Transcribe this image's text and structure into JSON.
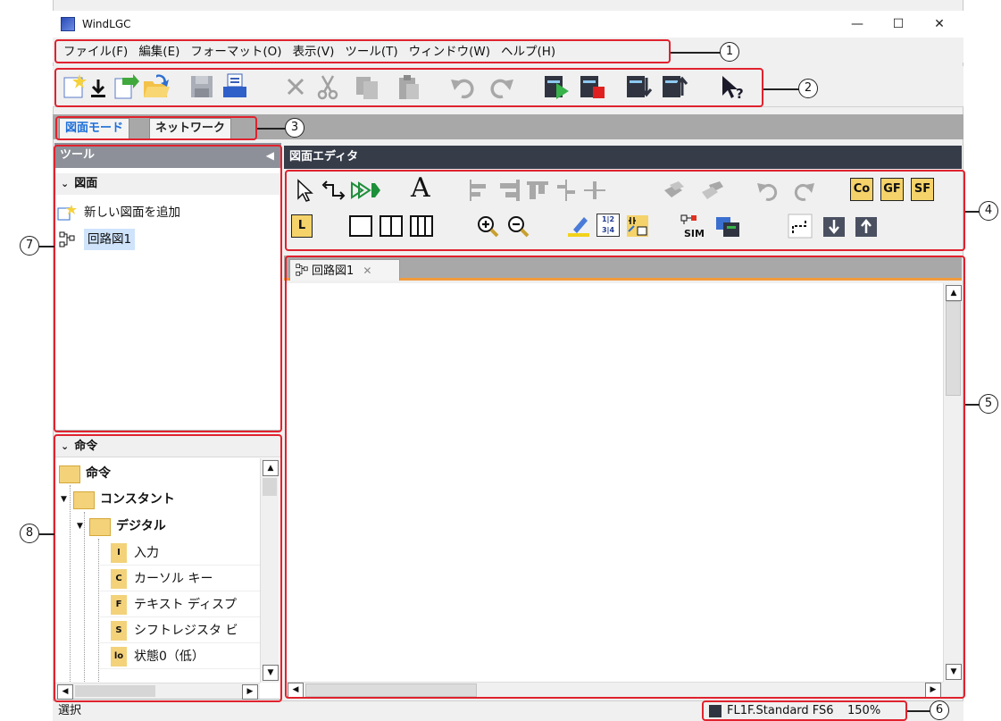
{
  "window": {
    "title": "WindLGC",
    "controls": [
      "—",
      "☐",
      "✕"
    ]
  },
  "menu": [
    "ファイル(F)",
    "編集(E)",
    "フォーマット(O)",
    "表示(V)",
    "ツール(T)",
    "ウィンドウ(W)",
    "ヘルプ(H)"
  ],
  "mode_tabs": {
    "diagram": "図面モード",
    "network": "ネットワーク"
  },
  "tool_panel": {
    "header": "ツール",
    "section": "図面",
    "add_item": "新しい図面を追加",
    "circuit_item": "回路図1"
  },
  "command_panel": {
    "header": "命令",
    "root": "命令",
    "constants": "コンスタント",
    "digital": "デジタル",
    "items": [
      {
        "badge": "I",
        "label": "入力"
      },
      {
        "badge": "C",
        "label": "カーソル キー"
      },
      {
        "badge": "F",
        "label": "テキスト ディスプ"
      },
      {
        "badge": "S",
        "label": "シフトレジスタ ビ"
      },
      {
        "badge": "lo",
        "label": "状態0（低）"
      }
    ]
  },
  "editor": {
    "header": "図面エディタ",
    "tab_label": "回路図1",
    "tab_close": "✕",
    "label_buttons": [
      "Co",
      "GF",
      "SF"
    ],
    "l_button": "L",
    "text_tool": "A",
    "sim_label": "SIM",
    "grid_label": "1|2 3|4"
  },
  "status": {
    "left": "選択",
    "device": "FL1F.Standard FS6",
    "zoom": "150%"
  },
  "callouts": [
    "1",
    "2",
    "3",
    "4",
    "5",
    "6",
    "7",
    "8"
  ],
  "colors": {
    "callout": "#e0222e",
    "editor_header": "#373c49",
    "tab_accent": "#f29b3c",
    "selection": "#cfe3fb",
    "folder": "#f3d27a"
  }
}
